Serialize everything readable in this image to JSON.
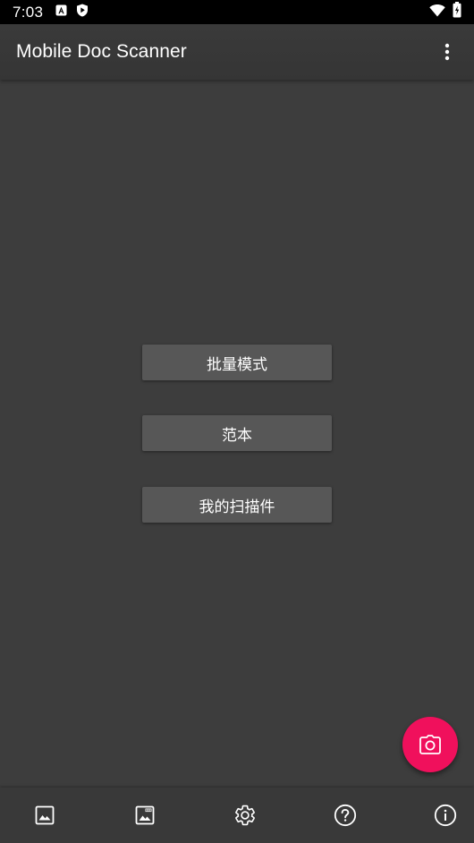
{
  "status_bar": {
    "time": "7:03",
    "icons": [
      "autofill-icon",
      "shield-icon",
      "wifi-icon",
      "battery-icon"
    ]
  },
  "app_bar": {
    "title": "Mobile Doc Scanner",
    "overflow_icon": "more-vert-icon"
  },
  "main": {
    "buttons": [
      {
        "label": "批量模式"
      },
      {
        "label": "范本"
      },
      {
        "label": "我的扫描件"
      }
    ]
  },
  "fab": {
    "icon": "camera-icon",
    "color": "#f0105c"
  },
  "bottom_nav": {
    "items": [
      {
        "icon": "image-icon"
      },
      {
        "icon": "pdf-image-icon"
      },
      {
        "icon": "gear-icon"
      },
      {
        "icon": "help-circle-icon"
      },
      {
        "icon": "info-circle-icon"
      }
    ]
  },
  "colors": {
    "background": "#3d3d3d",
    "status_bar": "#000000",
    "button": "#575757",
    "accent": "#f0105c"
  }
}
